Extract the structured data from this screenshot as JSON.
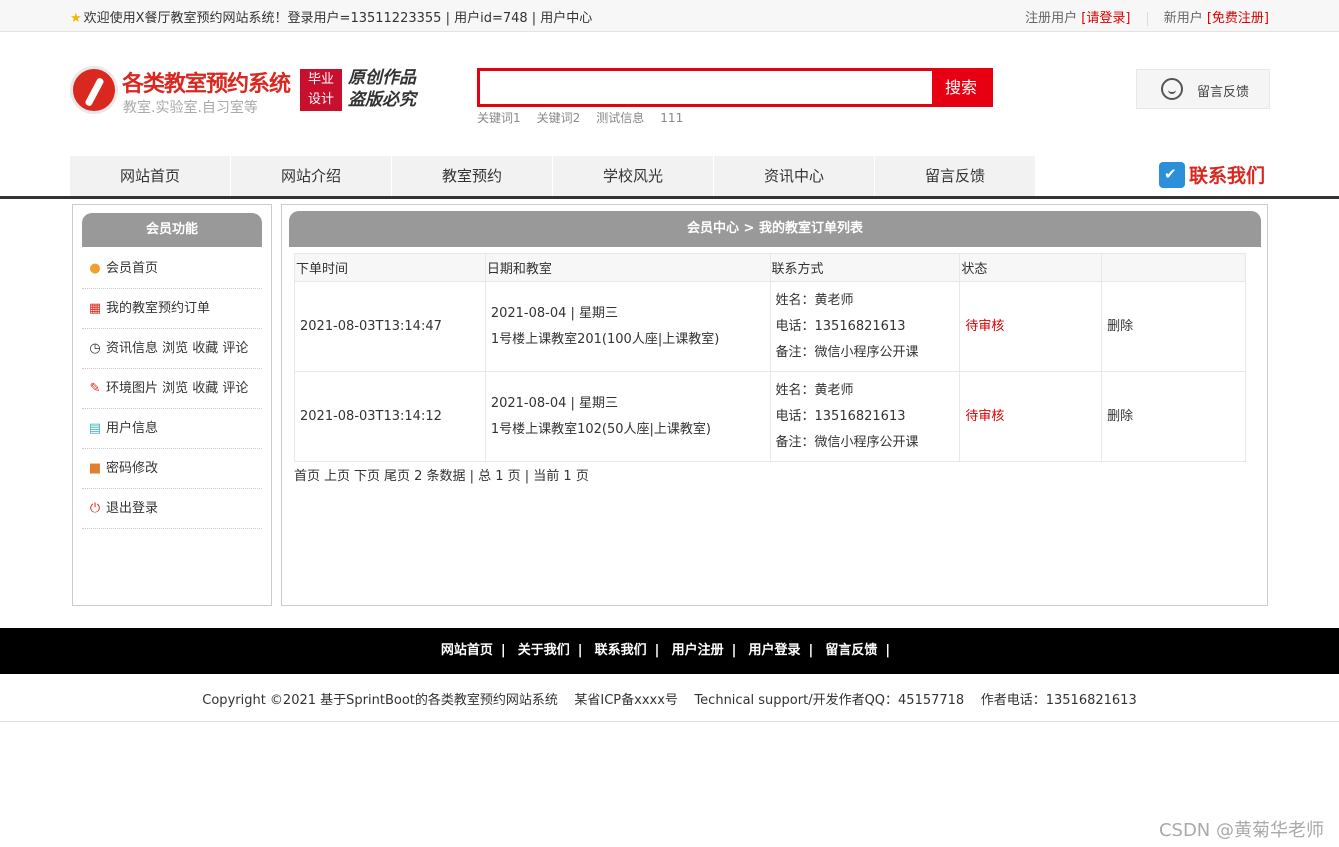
{
  "topbar": {
    "welcome": "欢迎使用X餐厅教室预约网站系统！登录用户=13511223355 | 用户id=748 | 用户中心",
    "register_label": "注册用户",
    "login_link": "[请登录]",
    "new_user_label": "新用户",
    "free_register_link": "[免费注册]"
  },
  "header": {
    "title": "各类教室预约系统",
    "subtitle": "教室.实验室.自习室等",
    "badge_line1": "毕业",
    "badge_line2": "设计",
    "slogan_line1": "原创作品",
    "slogan_line2": "盗版必究",
    "search_placeholder": "",
    "search_button": "搜索",
    "keywords": [
      "关键词1",
      "关键词2",
      "测试信息",
      "111"
    ],
    "feedback_label": "留言反馈"
  },
  "nav": {
    "items": [
      "网站首页",
      "网站介绍",
      "教室预约",
      "学校风光",
      "资讯中心",
      "留言反馈"
    ],
    "contact_label": "联系我们"
  },
  "sidebar": {
    "title": "会员功能",
    "items": [
      {
        "icon": "circle-icon",
        "label": "会员首页"
      },
      {
        "icon": "grid-icon",
        "label": "我的教室预约订单"
      },
      {
        "icon": "clock-icon",
        "label": "资讯信息 浏览 收藏 评论"
      },
      {
        "icon": "edit-icon",
        "label": "环境图片 浏览 收藏 评论"
      },
      {
        "icon": "clipboard-icon",
        "label": "用户信息"
      },
      {
        "icon": "lock-icon",
        "label": "密码修改"
      },
      {
        "icon": "power-icon",
        "label": "退出登录"
      }
    ]
  },
  "main": {
    "title": "会员中心 > 我的教室订单列表",
    "columns": [
      "下单时间",
      "日期和教室",
      "联系方式",
      "状态",
      ""
    ],
    "rows": [
      {
        "order_time": "2021-08-03T13:14:47",
        "date": "2021-08-04 | 星期三",
        "room": "1号楼上课教室201(100人座|上课教室)",
        "name": "姓名：黄老师",
        "phone": "电话：13516821613",
        "note": "备注：微信小程序公开课",
        "status": "待审核",
        "action": "删除"
      },
      {
        "order_time": "2021-08-03T13:14:12",
        "date": "2021-08-04 | 星期三",
        "room": "1号楼上课教室102(50人座|上课教室)",
        "name": "姓名：黄老师",
        "phone": "电话：13516821613",
        "note": "备注：微信小程序公开课",
        "status": "待审核",
        "action": "删除"
      }
    ],
    "pager": {
      "first": "首页",
      "prev": "上页",
      "next": "下页",
      "last": "尾页",
      "summary": "2 条数据 | 总 1 页 | 当前 1 页"
    }
  },
  "footer": {
    "links": [
      "网站首页",
      "关于我们",
      "联系我们",
      "用户注册",
      "用户登录",
      "留言反馈"
    ],
    "separator": "|",
    "copyright": "Copyright ©2021 基于SprintBoot的各类教室预约网站系统    某省ICP备xxxx号    Technical support/开发作者QQ：45157718    作者电话：13516821613"
  },
  "watermark": "CSDN @黄菊华老师",
  "colors": {
    "accent_red": "#e60012",
    "brand_red": "#d9281f",
    "panel_gray": "#999999",
    "footer_bg": "#000000"
  }
}
